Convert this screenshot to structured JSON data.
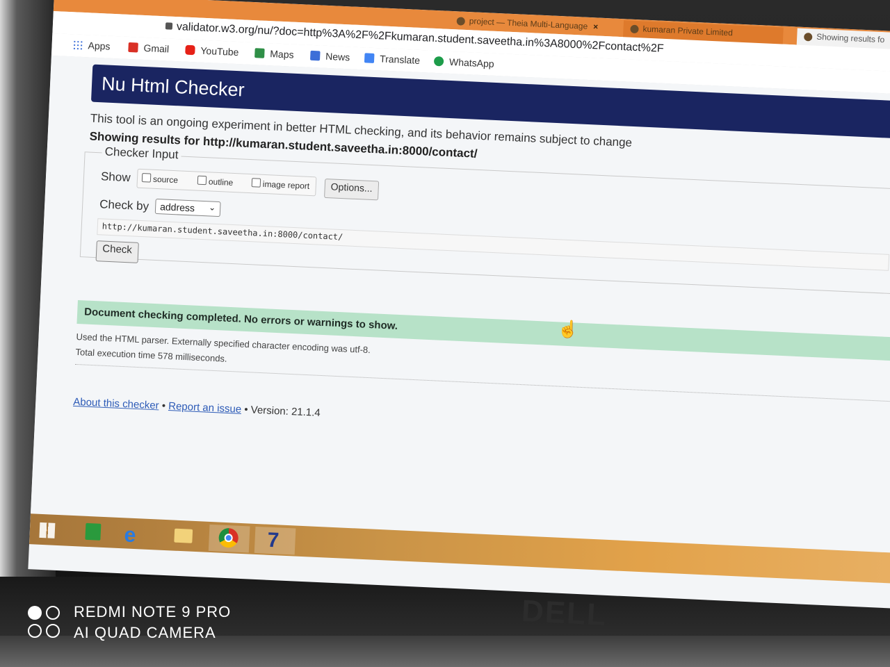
{
  "browser": {
    "tabs": [
      {
        "label": "project — Theia Multi-Language",
        "close": "×"
      },
      {
        "label": "kumaran Private Limited",
        "close": ""
      },
      {
        "label": "Showing results fo",
        "close": ""
      }
    ],
    "url": "validator.w3.org/nu/?doc=http%3A%2F%2Fkumaran.student.saveetha.in%3A8000%2Fcontact%2F",
    "bookmarks": [
      "Apps",
      "Gmail",
      "YouTube",
      "Maps",
      "News",
      "Translate",
      "WhatsApp"
    ]
  },
  "page": {
    "title": "Nu Html Checker",
    "lead": "This tool is an ongoing experiment in better HTML checking, and its behavior remains subject to change",
    "results_for": "Showing results for http://kumaran.student.saveetha.in:8000/contact/",
    "checker": {
      "legend": "Checker Input",
      "show_label": "Show",
      "opt_source": "source",
      "opt_outline": "outline",
      "opt_image_report": "image report",
      "options_button": "Options...",
      "check_by_label": "Check by",
      "check_by_value": "address",
      "url_value": "http://kumaran.student.saveetha.in:8000/contact/",
      "check_button": "Check"
    },
    "success_message": "Document checking completed. No errors or warnings to show.",
    "meta_parser": "Used the HTML parser. Externally specified character encoding was utf-8.",
    "meta_time": "Total execution time 578 milliseconds.",
    "footer": {
      "about": "About this checker",
      "sep1": "•",
      "report": "Report an issue",
      "version": "• Version: 21.1.4"
    }
  },
  "taskbar": {
    "apps": [
      "start-icon",
      "store-icon",
      "internet-explorer-icon",
      "file-explorer-icon",
      "chrome-icon",
      "app-7-icon"
    ]
  },
  "laptop": {
    "brand": "DELL"
  },
  "watermark": {
    "line1": "REDMI NOTE 9 PRO",
    "line2": "AI QUAD CAMERA"
  },
  "colors": {
    "banner": "#1a2561",
    "success": "#b7e2c8",
    "tabbar": "#e8893c",
    "taskbar": "#c99347"
  }
}
